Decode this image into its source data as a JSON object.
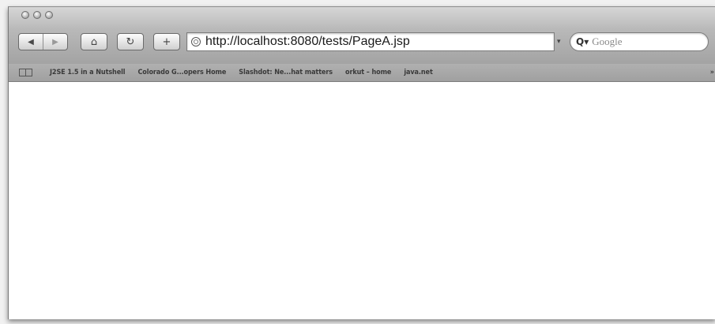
{
  "toolbar": {
    "back_icon": "back-arrow-icon",
    "forward_icon": "forward-arrow-icon",
    "home_icon": "home-icon",
    "reload_icon": "reload-icon",
    "add_bookmark_icon": "plus-icon",
    "back_glyph": "◀",
    "forward_glyph": "▶",
    "home_glyph": "⌂",
    "reload_glyph": "↻",
    "add_glyph": "+"
  },
  "address_bar": {
    "url": "http://localhost:8080/tests/PageA.jsp",
    "dropdown_glyph": "▾"
  },
  "search": {
    "placeholder": "Google",
    "glyph": "Q▾"
  },
  "bookmarks_bar": {
    "items": [
      "J2SE 1.5 in a Nutshell",
      "Colorado G...opers Home",
      "Slashdot: Ne...hat matters",
      "orkut – home",
      "java.net"
    ],
    "overflow": "»"
  },
  "colors": {
    "titlebar": "#c8c8c8",
    "toolbar": "#adadad",
    "content": "#ffffff"
  }
}
